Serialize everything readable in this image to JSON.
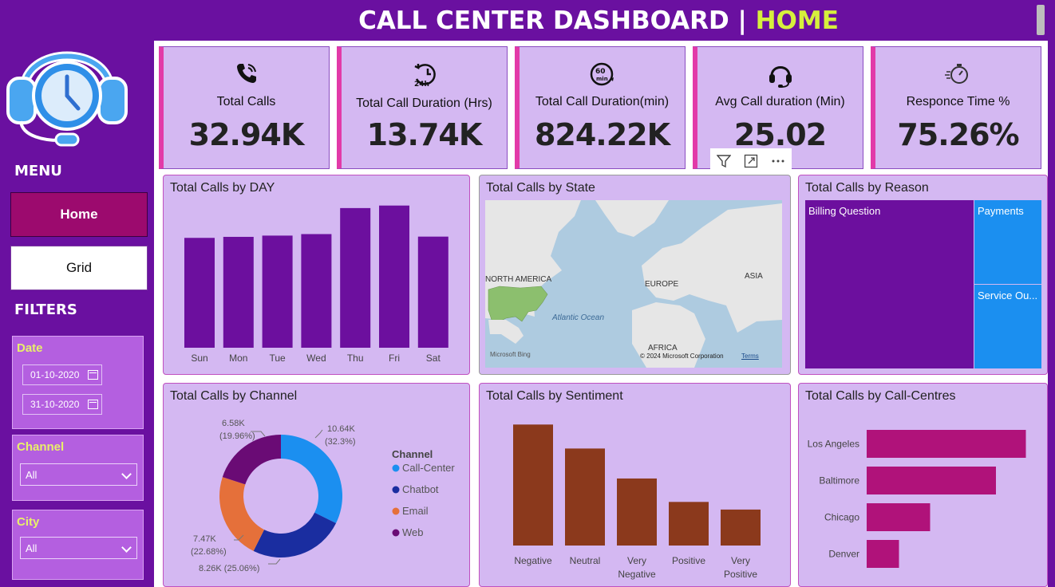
{
  "header": {
    "title_main": "CALL CENTER DASHBOARD | ",
    "title_accent": "HOME"
  },
  "sidebar": {
    "menu_heading": "MENU",
    "nav": [
      {
        "label": "Home",
        "active": true
      },
      {
        "label": "Grid",
        "active": false
      }
    ],
    "filters_heading": "FILTERS",
    "date_filter": {
      "label": "Date",
      "start": "01-10-2020",
      "end": "31-10-2020"
    },
    "channel_filter": {
      "label": "Channel",
      "value": "All"
    },
    "city_filter": {
      "label": "City",
      "value": "All"
    }
  },
  "kpis": [
    {
      "label": "Total Calls",
      "value": "32.94K",
      "icon": "phone-icon"
    },
    {
      "label": "Total Call Duration (Hrs)",
      "value": "13.74K",
      "icon": "24h-clock-icon"
    },
    {
      "label": "Total Call Duration(min)",
      "value": "824.22K",
      "icon": "60-min-clock-icon"
    },
    {
      "label": "Avg Call duration (Min)",
      "value": "25.02",
      "icon": "headset-icon"
    },
    {
      "label": "Responce Time %",
      "value": "75.26%",
      "icon": "stopwatch-icon"
    }
  ],
  "visual_tools": {
    "filter": "filter-icon",
    "focus": "focus-mode-icon",
    "more": "more-options-icon"
  },
  "panels": {
    "by_day": {
      "title": "Total Calls by DAY"
    },
    "by_state": {
      "title": "Total Calls by State"
    },
    "by_reason": {
      "title": "Total Calls by Reason"
    },
    "by_channel": {
      "title": "Total Calls by Channel"
    },
    "by_sentiment": {
      "title": "Total Calls by Sentiment"
    },
    "by_centre": {
      "title": "Total Calls by Call-Centres"
    }
  },
  "map": {
    "labels": {
      "na": "NORTH AMERICA",
      "eu": "EUROPE",
      "asia": "ASIA",
      "africa": "AFRICA",
      "ocean": "Atlantic Ocean"
    },
    "bing": "Microsoft Bing",
    "copyright": "© 2024 Microsoft Corporation",
    "terms": "Terms"
  },
  "colors": {
    "purple": "#6a10a0",
    "bar_purple": "#6c0f9e",
    "sentiment_brown": "#8b391c",
    "centre_magenta": "#b0127a",
    "treemap_blue": "#1b8ff0"
  },
  "chart_data": [
    {
      "type": "bar",
      "title": "Total Calls by DAY",
      "categories": [
        "Sun",
        "Mon",
        "Tue",
        "Wed",
        "Thu",
        "Fri",
        "Sat"
      ],
      "values": [
        4350,
        4390,
        4440,
        4500,
        5530,
        5630,
        4400
      ],
      "ylim": [
        0,
        6000
      ]
    },
    {
      "type": "treemap",
      "title": "Total Calls by Reason",
      "categories": [
        "Billing Question",
        "Payments",
        "Service Ou..."
      ],
      "values": [
        23460,
        4750,
        4730
      ]
    },
    {
      "type": "pie",
      "title": "Total Calls by Channel",
      "legend_title": "Channel",
      "categories": [
        "Call-Center",
        "Chatbot",
        "Email",
        "Web"
      ],
      "values": [
        10.64,
        8.26,
        7.47,
        6.58
      ],
      "labels": [
        "10.64K",
        "8.26K",
        "7.47K",
        "6.58K"
      ],
      "percents": [
        "(32.3%)",
        "(25.06%)",
        "(22.68%)",
        "(19.96%)"
      ],
      "colors": [
        "#1b8ff0",
        "#1a2da0",
        "#e5703a",
        "#6a0b75"
      ]
    },
    {
      "type": "bar",
      "title": "Total Calls by Sentiment",
      "categories": [
        "Negative",
        "Neutral",
        "Very Negative",
        "Positive",
        "Very Positive"
      ],
      "values": [
        11100,
        8900,
        6150,
        4000,
        3300
      ],
      "ylim": [
        0,
        12000
      ]
    },
    {
      "type": "bar",
      "orientation": "horizontal",
      "title": "Total Calls by Call-Centres",
      "categories": [
        "Los Angeles",
        "Baltimore",
        "Chicago",
        "Denver"
      ],
      "values": [
        13300,
        10800,
        5300,
        2700
      ],
      "xlim": [
        0,
        14000
      ]
    }
  ]
}
